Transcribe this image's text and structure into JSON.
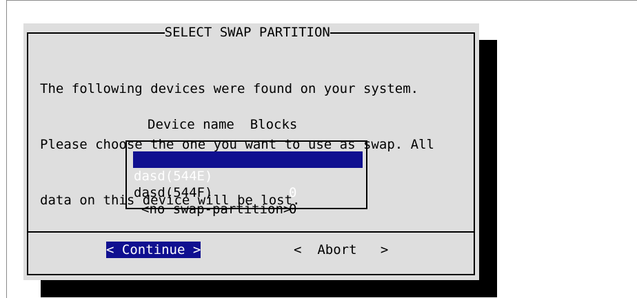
{
  "dialog": {
    "title": "SELECT SWAP PARTITION",
    "message_lines": [
      "The following devices were found on your system.",
      "Please choose the one you want to use as swap. All",
      "data on this device will be lost."
    ],
    "columns": {
      "name": "Device name",
      "blocks": "Blocks"
    },
    "devices": [
      {
        "name": "dasd(544E)",
        "blocks": "0",
        "selected": true
      },
      {
        "name": "dasd(544F)",
        "blocks": "0",
        "selected": false
      }
    ],
    "no_swap_option": "<no swap-partition>",
    "buttons": {
      "continue": "< Continue >",
      "abort": "<  Abort   >"
    }
  },
  "colors": {
    "dialog_background": "#dedede",
    "highlight": "#101090",
    "shadow": "#000000"
  }
}
